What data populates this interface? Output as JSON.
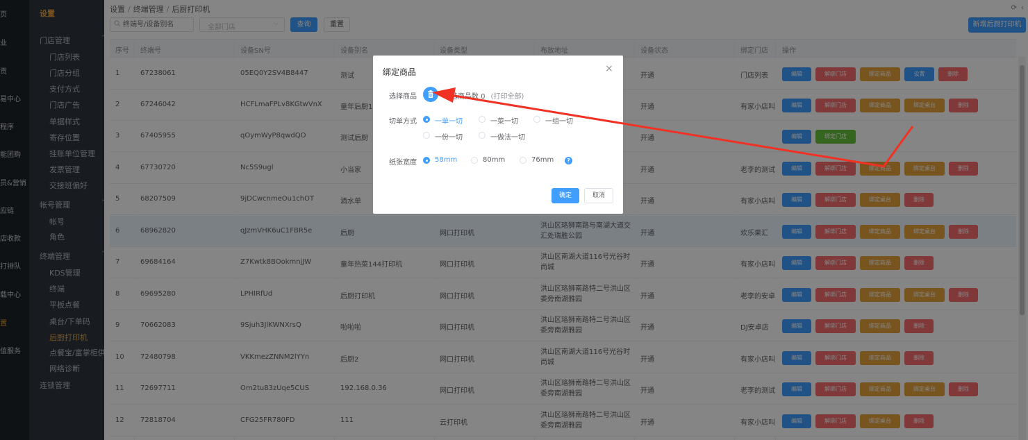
{
  "nav_primary": [
    {
      "label": "页",
      "active": false
    },
    {
      "label": "业",
      "active": false
    },
    {
      "label": "贡",
      "active": false
    },
    {
      "label": "易中心",
      "active": false
    },
    {
      "label": "程序",
      "active": false
    },
    {
      "label": "能团购",
      "active": false
    },
    {
      "label": "员&营销",
      "active": false
    },
    {
      "label": "应链",
      "active": false
    },
    {
      "label": "店收款",
      "active": false
    },
    {
      "label": "打排队",
      "active": false
    },
    {
      "label": "载中心",
      "active": false
    },
    {
      "label": "置",
      "active": true
    },
    {
      "label": "值服务",
      "active": false
    }
  ],
  "nav_secondary": {
    "title": "设置",
    "groups": [
      {
        "label": "门店管理",
        "items": [
          {
            "label": "门店列表"
          },
          {
            "label": "门店分组"
          },
          {
            "label": "支付方式"
          },
          {
            "label": "门店广告"
          },
          {
            "label": "单据样式"
          },
          {
            "label": "寄存位置"
          },
          {
            "label": "挂账单位管理"
          },
          {
            "label": "发票管理"
          },
          {
            "label": "交接班偏好"
          }
        ]
      },
      {
        "label": "帐号管理",
        "items": [
          {
            "label": "帐号"
          },
          {
            "label": "角色"
          }
        ]
      },
      {
        "label": "终端管理",
        "items": [
          {
            "label": "KDS管理"
          },
          {
            "label": "终端"
          },
          {
            "label": "平板点餐"
          },
          {
            "label": "桌台/下单码"
          },
          {
            "label": "后厨打印机",
            "active": true
          },
          {
            "label": "点餐宝/富掌柜供货"
          },
          {
            "label": "网络诊断"
          }
        ]
      },
      {
        "label": "连锁管理",
        "items": []
      }
    ]
  },
  "breadcrumb": [
    "设置",
    "终端管理",
    "后厨打印机"
  ],
  "toolbar": {
    "search_placeholder": "终端号/设备别名",
    "store_select": "全部门店",
    "query_label": "查询",
    "reset_label": "重置",
    "add_label": "新增后厨打印机"
  },
  "table": {
    "headers": [
      "序号",
      "终端号",
      "设备SN号",
      "设备别名",
      "设备类型",
      "布放地址",
      "设备状态",
      "绑定门店",
      "操作"
    ],
    "rows": [
      {
        "no": "1",
        "terminal": "67238061",
        "sn": "05EQ0Y2SV4B8447",
        "alias": "测试",
        "type": "",
        "address": "",
        "status": "开通",
        "store": "门店列表",
        "actions": [
          "编辑",
          "解绑门店",
          "绑定商品",
          "设置",
          "删除"
        ]
      },
      {
        "no": "2",
        "terminal": "67246042",
        "sn": "HCFLmaFPLv8KGtwVnX",
        "alias": "童年后厨1",
        "type": "",
        "address": "",
        "status": "开通",
        "store": "有家小店叫",
        "actions": [
          "编辑",
          "解绑门店",
          "绑定商品",
          "绑定桌台",
          "删除"
        ]
      },
      {
        "no": "3",
        "terminal": "67405955",
        "sn": "qOymWyP8qwdQO",
        "alias": "测试后厨",
        "type": "",
        "address": "",
        "status": "开通",
        "store": "",
        "actions": [
          "编辑",
          "绑定门店"
        ]
      },
      {
        "no": "4",
        "terminal": "67730720",
        "sn": "Nc5S9ugl",
        "alias": "小当家",
        "type": "",
        "address": "",
        "status": "开通",
        "store": "老李的测试",
        "actions": [
          "编辑",
          "解绑门店",
          "绑定商品",
          "绑定桌台",
          "删除"
        ]
      },
      {
        "no": "5",
        "terminal": "68207509",
        "sn": "9jDCwcnmeOu1chOT",
        "alias": "酒水单",
        "type": "",
        "address": "",
        "status": "开通",
        "store": "有家小店叫",
        "actions": [
          "编辑",
          "解绑门店",
          "绑定桌台",
          "删除"
        ]
      },
      {
        "no": "6",
        "terminal": "68962820",
        "sn": "qJzmVHK6uC1FBR5e",
        "alias": "后厨",
        "type": "网口打印机",
        "address": "洪山区珞狮南路与南湖大道交汇处瑞胜公园",
        "status": "开通",
        "store": "欢乐果汇",
        "actions": [
          "编辑",
          "解绑门店",
          "绑定商品",
          "绑定桌台",
          "删除"
        ]
      },
      {
        "no": "7",
        "terminal": "69684164",
        "sn": "Z7Kwtk8BOokmnjJW",
        "alias": "童年热菜144打印机",
        "type": "网口打印机",
        "address": "洪山区南湖大道116号光谷时尚城",
        "status": "开通",
        "store": "有家小店叫",
        "actions": [
          "编辑",
          "解绑门店",
          "绑定商品",
          "删除"
        ]
      },
      {
        "no": "8",
        "terminal": "69695280",
        "sn": "LPHIRfUd",
        "alias": "后厨打印机",
        "type": "网口打印机",
        "address": "洪山区珞狮南路特二号洪山区委旁南湖雅园",
        "status": "开通",
        "store": "老李的安卓",
        "actions": [
          "编辑",
          "解绑门店",
          "绑定商品",
          "绑定桌台",
          "删除"
        ]
      },
      {
        "no": "9",
        "terminal": "70662083",
        "sn": "9Sjuh3JlKWNXrsQ",
        "alias": "啦啦啦",
        "type": "网口打印机",
        "address": "洪山区珞狮南路特二号洪山区委旁南湖雅园",
        "status": "开通",
        "store": "DJ安卓店",
        "actions": [
          "编辑",
          "解绑门店",
          "绑定商品",
          "删除"
        ]
      },
      {
        "no": "10",
        "terminal": "72480798",
        "sn": "VKKmezZNNM2lYYn",
        "alias": "后厨2",
        "type": "网口打印机",
        "address": "洪山区南湖大道116号光谷时尚城",
        "status": "开通",
        "store": "有家小店叫",
        "actions": [
          "编辑",
          "解绑门店",
          "绑定商品",
          "删除"
        ]
      },
      {
        "no": "11",
        "terminal": "72697711",
        "sn": "Om2tu83zUqe5CUS",
        "alias": "192.168.0.36",
        "type": "网口打印机",
        "address": "洪山区珞狮南路特二号洪山区委旁南湖雅园",
        "status": "开通",
        "store": "老李的测试",
        "actions": [
          "编辑",
          "解绑门店",
          "绑定商品",
          "绑定桌台",
          "删除"
        ]
      },
      {
        "no": "12",
        "terminal": "72818704",
        "sn": "CFG25FR780FD",
        "alias": "111",
        "type": "云打印机",
        "address": "洪山区珞狮南路特二号洪山区委旁南湖雅园",
        "status": "开通",
        "store": "有家小店叫",
        "actions": [
          "编辑",
          "解绑门店",
          "绑定桌台",
          "删除"
        ]
      }
    ]
  },
  "dialog": {
    "title": "绑定商品",
    "close": "×",
    "select_goods_label": "选择商品",
    "selected_count": "已选商品数 0",
    "print_all_hint": "(打印全部)",
    "cut_mode_label": "切单方式",
    "cut_options": [
      {
        "label": "一单一切",
        "checked": true
      },
      {
        "label": "一菜一切",
        "checked": false
      },
      {
        "label": "一组一切",
        "checked": false
      },
      {
        "label": "一份一切",
        "checked": false
      },
      {
        "label": "一做法一切",
        "checked": false
      }
    ],
    "paper_label": "纸张宽度",
    "paper_options": [
      {
        "label": "58mm",
        "checked": true
      },
      {
        "label": "80mm",
        "checked": false
      },
      {
        "label": "76mm",
        "checked": false
      }
    ],
    "help": "?",
    "ok_label": "确定",
    "cancel_label": "取消"
  },
  "colors": {
    "primary": "#409eff",
    "danger": "#f56c6c",
    "warning": "#e6a23c",
    "success": "#67c23a",
    "annotation_arrow": "#f03224",
    "sidebar_active": "#e6a23c"
  }
}
